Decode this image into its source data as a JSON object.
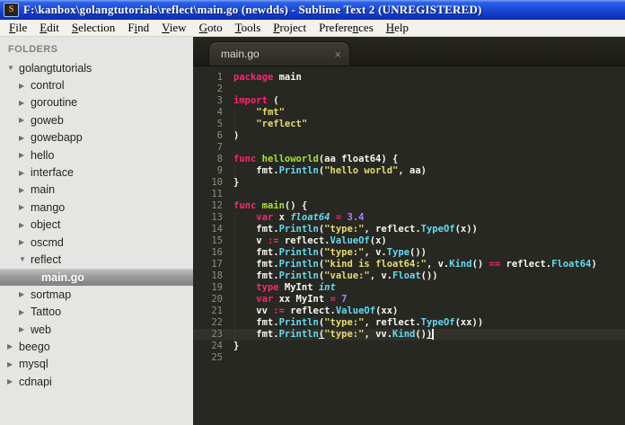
{
  "window": {
    "title": "F:\\kanbox\\golangtutorials\\reflect\\main.go (newdds) - Sublime Text 2 (UNREGISTERED)",
    "icon_letter": "S"
  },
  "menu": {
    "items": [
      {
        "label": "File",
        "accel_index": 0
      },
      {
        "label": "Edit",
        "accel_index": 0
      },
      {
        "label": "Selection",
        "accel_index": 0
      },
      {
        "label": "Find",
        "accel_index": 1
      },
      {
        "label": "View",
        "accel_index": 0
      },
      {
        "label": "Goto",
        "accel_index": 0
      },
      {
        "label": "Tools",
        "accel_index": 0
      },
      {
        "label": "Project",
        "accel_index": 0
      },
      {
        "label": "Preferences",
        "accel_index": 7
      },
      {
        "label": "Help",
        "accel_index": 0
      }
    ]
  },
  "icons": {
    "expanded": "▼",
    "collapsed": "▶"
  },
  "sidebar": {
    "header": "FOLDERS",
    "items": [
      {
        "label": "golangtutorials",
        "level": 0,
        "type": "folder",
        "state": "expanded"
      },
      {
        "label": "control",
        "level": 1,
        "type": "folder",
        "state": "collapsed"
      },
      {
        "label": "goroutine",
        "level": 1,
        "type": "folder",
        "state": "collapsed"
      },
      {
        "label": "goweb",
        "level": 1,
        "type": "folder",
        "state": "collapsed"
      },
      {
        "label": "gowebapp",
        "level": 1,
        "type": "folder",
        "state": "collapsed"
      },
      {
        "label": "hello",
        "level": 1,
        "type": "folder",
        "state": "collapsed"
      },
      {
        "label": "interface",
        "level": 1,
        "type": "folder",
        "state": "collapsed"
      },
      {
        "label": "main",
        "level": 1,
        "type": "folder",
        "state": "collapsed"
      },
      {
        "label": "mango",
        "level": 1,
        "type": "folder",
        "state": "collapsed"
      },
      {
        "label": "object",
        "level": 1,
        "type": "folder",
        "state": "collapsed"
      },
      {
        "label": "oscmd",
        "level": 1,
        "type": "folder",
        "state": "collapsed"
      },
      {
        "label": "reflect",
        "level": 1,
        "type": "folder",
        "state": "expanded"
      },
      {
        "label": "main.go",
        "level": 2,
        "type": "file",
        "selected": true
      },
      {
        "label": "sortmap",
        "level": 1,
        "type": "folder",
        "state": "collapsed"
      },
      {
        "label": "Tattoo",
        "level": 1,
        "type": "folder",
        "state": "collapsed"
      },
      {
        "label": "web",
        "level": 1,
        "type": "folder",
        "state": "collapsed"
      },
      {
        "label": "beego",
        "level": 0,
        "type": "folder",
        "state": "collapsed"
      },
      {
        "label": "mysql",
        "level": 0,
        "type": "folder",
        "state": "collapsed"
      },
      {
        "label": "cdnapi",
        "level": 0,
        "type": "folder",
        "state": "collapsed"
      }
    ]
  },
  "tabs": [
    {
      "label": "main.go",
      "active": true,
      "close_icon": "×"
    }
  ],
  "editor": {
    "language": "go",
    "cursor_line": 23,
    "syntax_colors": {
      "keyword": "#f92672",
      "function_name": "#a6e22e",
      "support_function": "#66d9ef",
      "type_italic": "#66d9ef",
      "string": "#e6db74",
      "number": "#ae81ff",
      "plain": "#f8f8f2",
      "background": "#272822",
      "line_numbers": "#8c8c81"
    },
    "lines": [
      {
        "s": [
          [
            "k",
            "package"
          ],
          [
            "w",
            " main"
          ]
        ]
      },
      {
        "s": []
      },
      {
        "s": [
          [
            "k",
            "import"
          ],
          [
            "w",
            " ("
          ]
        ]
      },
      {
        "g": 1,
        "s": [
          [
            "w",
            "    "
          ],
          [
            "s",
            "\"fmt\""
          ]
        ]
      },
      {
        "g": 1,
        "s": [
          [
            "w",
            "    "
          ],
          [
            "s",
            "\"reflect\""
          ]
        ]
      },
      {
        "s": [
          [
            "w",
            ")"
          ]
        ]
      },
      {
        "s": []
      },
      {
        "s": [
          [
            "k",
            "func"
          ],
          [
            "w",
            " "
          ],
          [
            "f",
            "helloworld"
          ],
          [
            "w",
            "(aa float64) {"
          ]
        ]
      },
      {
        "g": 1,
        "s": [
          [
            "w",
            "    fmt."
          ],
          [
            "m",
            "Println"
          ],
          [
            "w",
            "("
          ],
          [
            "s",
            "\"hello world\""
          ],
          [
            "w",
            ", aa)"
          ]
        ]
      },
      {
        "s": [
          [
            "w",
            "}"
          ]
        ]
      },
      {
        "s": []
      },
      {
        "s": [
          [
            "k",
            "func"
          ],
          [
            "w",
            " "
          ],
          [
            "f",
            "main"
          ],
          [
            "w",
            "() {"
          ]
        ]
      },
      {
        "g": 1,
        "s": [
          [
            "w",
            "    "
          ],
          [
            "k",
            "var"
          ],
          [
            "w",
            " x "
          ],
          [
            "t",
            "float64"
          ],
          [
            "w",
            " "
          ],
          [
            "k",
            "="
          ],
          [
            "w",
            " "
          ],
          [
            "n",
            "3.4"
          ]
        ]
      },
      {
        "g": 1,
        "s": [
          [
            "w",
            "    fmt."
          ],
          [
            "m",
            "Println"
          ],
          [
            "w",
            "("
          ],
          [
            "s",
            "\"type:\""
          ],
          [
            "w",
            ", reflect."
          ],
          [
            "m",
            "TypeOf"
          ],
          [
            "w",
            "(x))"
          ]
        ]
      },
      {
        "g": 1,
        "s": [
          [
            "w",
            "    v "
          ],
          [
            "k",
            ":="
          ],
          [
            "w",
            " reflect."
          ],
          [
            "m",
            "ValueOf"
          ],
          [
            "w",
            "(x)"
          ]
        ]
      },
      {
        "g": 1,
        "s": [
          [
            "w",
            "    fmt."
          ],
          [
            "m",
            "Println"
          ],
          [
            "w",
            "("
          ],
          [
            "s",
            "\"type:\""
          ],
          [
            "w",
            ", v."
          ],
          [
            "m",
            "Type"
          ],
          [
            "w",
            "())"
          ]
        ]
      },
      {
        "g": 1,
        "s": [
          [
            "w",
            "    fmt."
          ],
          [
            "m",
            "Println"
          ],
          [
            "w",
            "("
          ],
          [
            "s",
            "\"kind is float64:\""
          ],
          [
            "w",
            ", v."
          ],
          [
            "m",
            "Kind"
          ],
          [
            "w",
            "() "
          ],
          [
            "k",
            "=="
          ],
          [
            "w",
            " reflect."
          ],
          [
            "m",
            "Float64"
          ],
          [
            "w",
            ")"
          ]
        ]
      },
      {
        "g": 1,
        "s": [
          [
            "w",
            "    fmt."
          ],
          [
            "m",
            "Println"
          ],
          [
            "w",
            "("
          ],
          [
            "s",
            "\"value:\""
          ],
          [
            "w",
            ", v."
          ],
          [
            "m",
            "Float"
          ],
          [
            "w",
            "())"
          ]
        ]
      },
      {
        "g": 1,
        "s": [
          [
            "w",
            "    "
          ],
          [
            "k",
            "type"
          ],
          [
            "w",
            " MyInt "
          ],
          [
            "t",
            "int"
          ]
        ]
      },
      {
        "g": 1,
        "s": [
          [
            "w",
            "    "
          ],
          [
            "k",
            "var"
          ],
          [
            "w",
            " xx MyInt "
          ],
          [
            "k",
            "="
          ],
          [
            "w",
            " "
          ],
          [
            "n",
            "7"
          ]
        ]
      },
      {
        "g": 1,
        "s": [
          [
            "w",
            "    vv "
          ],
          [
            "k",
            ":="
          ],
          [
            "w",
            " reflect."
          ],
          [
            "m",
            "ValueOf"
          ],
          [
            "w",
            "(xx)"
          ]
        ]
      },
      {
        "g": 1,
        "s": [
          [
            "w",
            "    fmt."
          ],
          [
            "m",
            "Println"
          ],
          [
            "w",
            "("
          ],
          [
            "s",
            "\"type:\""
          ],
          [
            "w",
            ", reflect."
          ],
          [
            "m",
            "TypeOf"
          ],
          [
            "w",
            "(xx))"
          ]
        ]
      },
      {
        "g": 1,
        "s": [
          [
            "w",
            "    fmt."
          ],
          [
            "m",
            "Println"
          ],
          [
            "wu",
            "("
          ],
          [
            "s",
            "\"type:\""
          ],
          [
            "w",
            ", vv."
          ],
          [
            "m",
            "Kind"
          ],
          [
            "w",
            "()"
          ],
          [
            "wu",
            ")"
          ],
          [
            "cur",
            ""
          ]
        ]
      },
      {
        "s": [
          [
            "w",
            "}"
          ]
        ]
      },
      {
        "s": []
      }
    ]
  }
}
